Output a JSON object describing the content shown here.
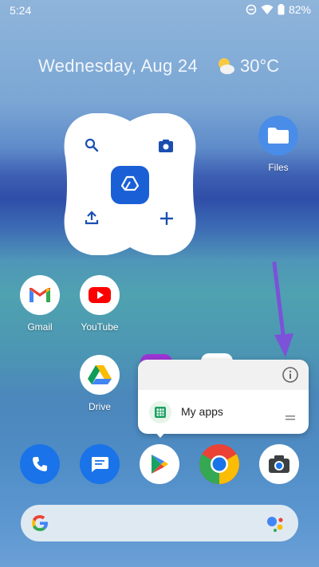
{
  "status_bar": {
    "time": "5:24",
    "battery": "82%"
  },
  "at_a_glance": {
    "date": "Wednesday, Aug 24",
    "temperature": "30°C",
    "weather_icon": "partly-cloudy-icon"
  },
  "widget": {
    "buttons": [
      "search-icon",
      "camera-icon",
      "upload-icon",
      "plus-icon"
    ],
    "center_icon": "drive-logo-icon",
    "accent": "#1a5fd6"
  },
  "apps": {
    "files": {
      "label": "Files"
    },
    "gmail": {
      "label": "Gmail"
    },
    "youtube": {
      "label": "YouTube"
    },
    "drive": {
      "label": "Drive"
    }
  },
  "dock": [
    "phone-icon",
    "messages-icon",
    "play-store-icon",
    "chrome-icon",
    "camera-icon"
  ],
  "popup": {
    "shortcut_label": "My apps",
    "info_icon": "info-icon",
    "handle_icon": "drag-handle-icon"
  },
  "colors": {
    "arrow": "#7b52d8",
    "play_green": "#1aa260"
  }
}
